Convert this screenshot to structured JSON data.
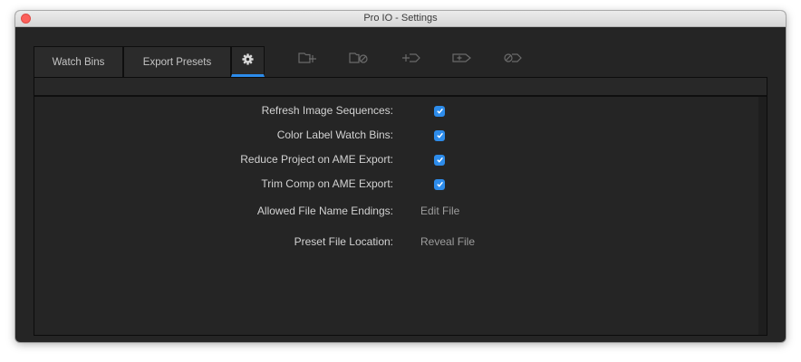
{
  "window": {
    "title": "Pro IO - Settings"
  },
  "tabs": [
    {
      "label": "Watch Bins"
    },
    {
      "label": "Export Presets"
    },
    {
      "icon": "gear-icon"
    }
  ],
  "toolbar": [
    {
      "icon": "add-bin-icon"
    },
    {
      "icon": "remove-bin-icon"
    },
    {
      "icon": "add-preset-icon"
    },
    {
      "icon": "add-preset-to-bin-icon"
    },
    {
      "icon": "remove-preset-icon"
    }
  ],
  "settings": {
    "refresh_image_sequences": {
      "label": "Refresh Image Sequences:",
      "checked": true
    },
    "color_label_watch_bins": {
      "label": "Color Label Watch Bins:",
      "checked": true
    },
    "reduce_project": {
      "label": "Reduce Project on AME Export:",
      "checked": true
    },
    "trim_comp": {
      "label": "Trim Comp on AME Export:",
      "checked": true
    },
    "allowed_endings": {
      "label": "Allowed File Name Endings:",
      "action": "Edit File"
    },
    "preset_location": {
      "label": "Preset File Location:",
      "action": "Reveal File"
    }
  },
  "colors": {
    "accent": "#2d8ceb",
    "background": "#252525",
    "close": "#fc605b"
  }
}
